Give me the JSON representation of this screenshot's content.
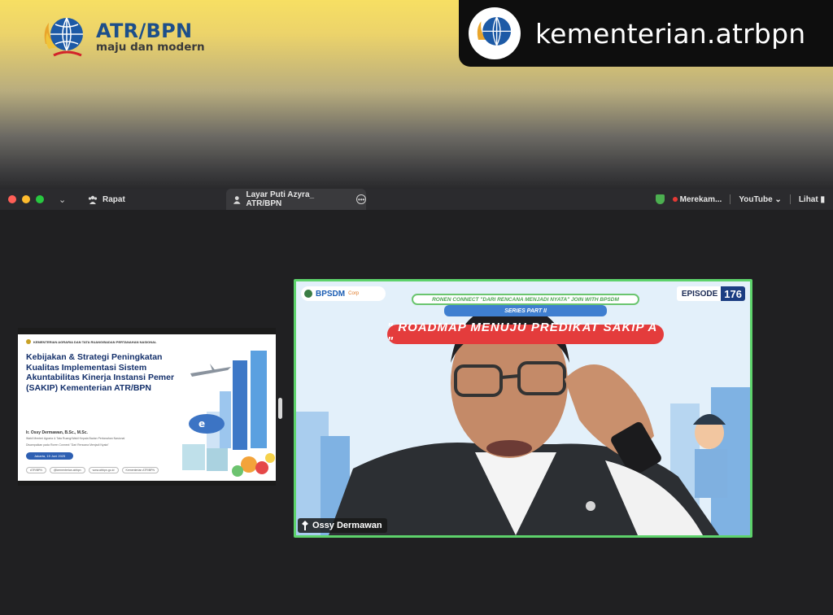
{
  "banner": {
    "brand_title": "ATR/BPN",
    "brand_subtitle": "maju dan modern",
    "handle": "kementerian.atrbpn"
  },
  "toolbar": {
    "tab_meeting": "Rapat",
    "tab_share": "Layar Puti Azyra_ ATR/BPN",
    "recording": "Merekam...",
    "youtube": "YouTube",
    "view": "Lihat"
  },
  "slide": {
    "header": "KEMENTERIAN AGRARIA DAN TATA RUANG/BADAN PERTANAHAN NASIONAL",
    "title": "Kebijakan & Strategi Peningkatan Kualitas Implementasi Sistem Akuntabilitas Kinerja Instansi Pemerintah (SAKIP) Kementerian ATR/BPN",
    "author": "Ir. Ossy Dermawan, B.Sc., M.Sc.",
    "author_role": "Wakil Menteri Agraria & Tata Ruang/Wakil Kepala Badan Pertanahan Nasional",
    "author_note": "Disampaikan pada Roren Connect \"Dari Rencana Menjadi Nyata\"",
    "date": "Jakarta, 19 Juni 2025",
    "links": [
      "ATR/BPN",
      "@kementerian.atrbpn",
      "www.atrbpn.go.id",
      "Kementerian ATR/BPN"
    ]
  },
  "video": {
    "logo": "BPSDM",
    "logo_sub": "Corp",
    "episode_label": "EPISODE",
    "episode_number": "176",
    "roren": "RONEN CONNECT \"DARI RENCANA MENJADI NYATA\" JOIN WITH BPSDM",
    "series": "SERIES PART II",
    "headline": "\" ROADMAP MENUJU PREDIKAT SAKIP A \"",
    "participant": "Ossy Dermawan"
  },
  "colors": {
    "accent_green": "#5dd26b",
    "brand_blue": "#1d4f8a",
    "record_red": "#e53935"
  }
}
